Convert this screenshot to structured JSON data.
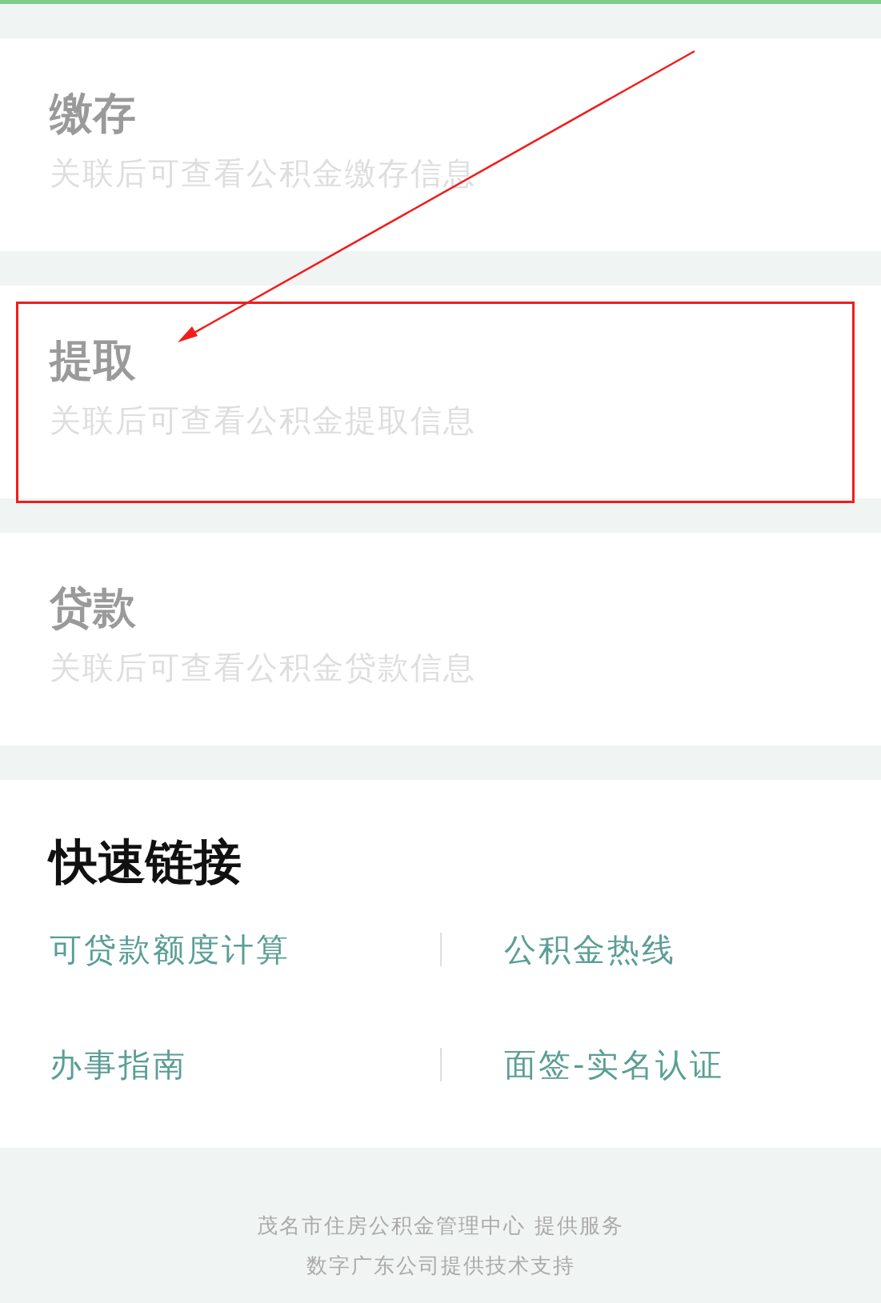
{
  "cards": [
    {
      "title": "缴存",
      "subtitle": "关联后可查看公积金缴存信息",
      "highlighted": false
    },
    {
      "title": "提取",
      "subtitle": "关联后可查看公积金提取信息",
      "highlighted": true
    },
    {
      "title": "贷款",
      "subtitle": "关联后可查看公积金贷款信息",
      "highlighted": false
    }
  ],
  "quick_links": {
    "title": "快速链接",
    "links": [
      "可贷款额度计算",
      "公积金热线",
      "办事指南",
      "面签-实名认证"
    ]
  },
  "footer": [
    "茂名市住房公积金管理中心 提供服务",
    "数字广东公司提供技术支持"
  ]
}
